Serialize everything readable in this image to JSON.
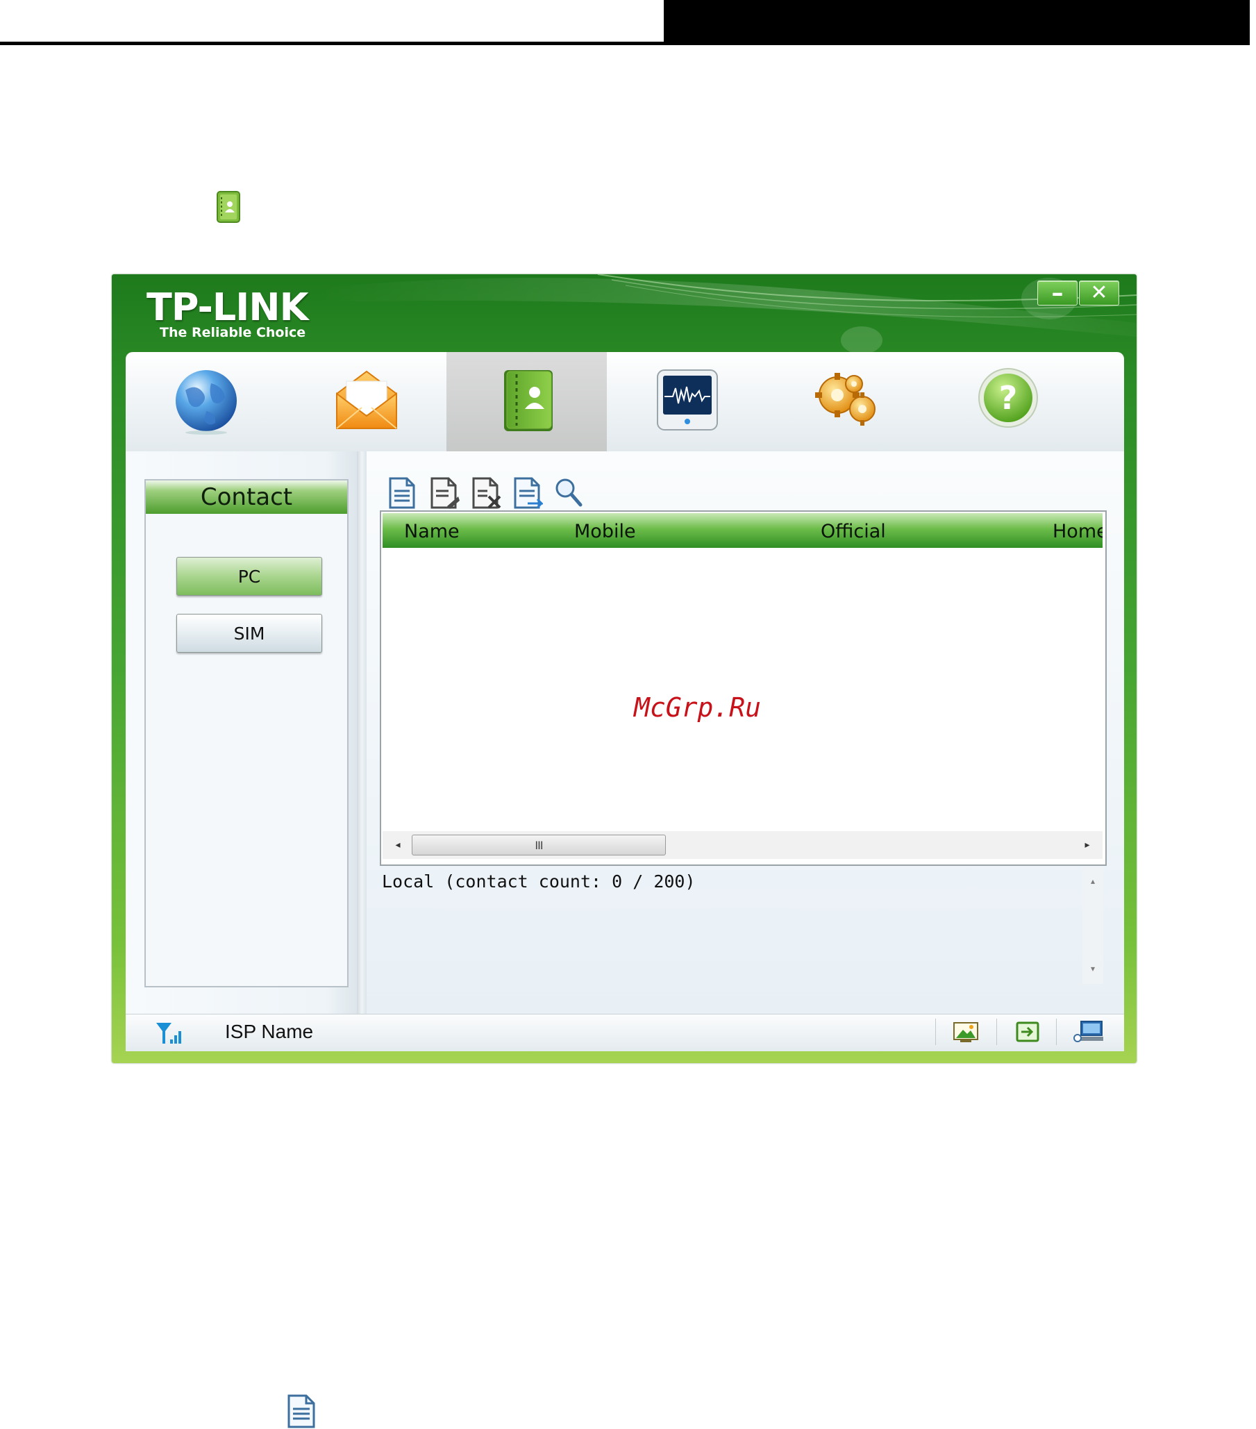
{
  "app": {
    "brand": "TP-LINK",
    "tagline": "The Reliable Choice",
    "window_controls": {
      "minimize": "–",
      "close": "✕"
    }
  },
  "nav_tabs": [
    {
      "id": "internet",
      "icon": "globe-icon",
      "active": false
    },
    {
      "id": "sms",
      "icon": "envelope-icon",
      "active": false
    },
    {
      "id": "contact",
      "icon": "contact-book-icon",
      "active": true
    },
    {
      "id": "statistics",
      "icon": "monitor-waveform-icon",
      "active": false
    },
    {
      "id": "settings",
      "icon": "gears-icon",
      "active": false
    },
    {
      "id": "help",
      "icon": "help-icon",
      "active": false
    }
  ],
  "sidebar": {
    "title": "Contact",
    "buttons": [
      "PC",
      "SIM"
    ],
    "selected": "PC"
  },
  "toolbar": {
    "buttons": [
      "new-contact-icon",
      "edit-contact-icon",
      "delete-contact-icon",
      "copy-contact-icon",
      "search-icon"
    ]
  },
  "table": {
    "columns": [
      "Name",
      "Mobile",
      "Official",
      "Home"
    ],
    "rows": []
  },
  "scrollbar": {
    "thumb_grip": "III",
    "left": "◂",
    "right": "▸",
    "up": "▴",
    "down": "▾"
  },
  "status": {
    "text": "Local (contact count: 0 / 200)"
  },
  "status_bar": {
    "isp_label": "ISP Name",
    "icons": [
      "signal-strength-icon",
      "picture-icon",
      "connection-icon",
      "network-computer-icon"
    ]
  },
  "watermark": "McGrp.Ru",
  "colors": {
    "brand_green_dark": "#1e7a1c",
    "brand_green_light": "#a6d352",
    "header_green": "#2f8e24",
    "watermark_red": "#c8121a"
  }
}
